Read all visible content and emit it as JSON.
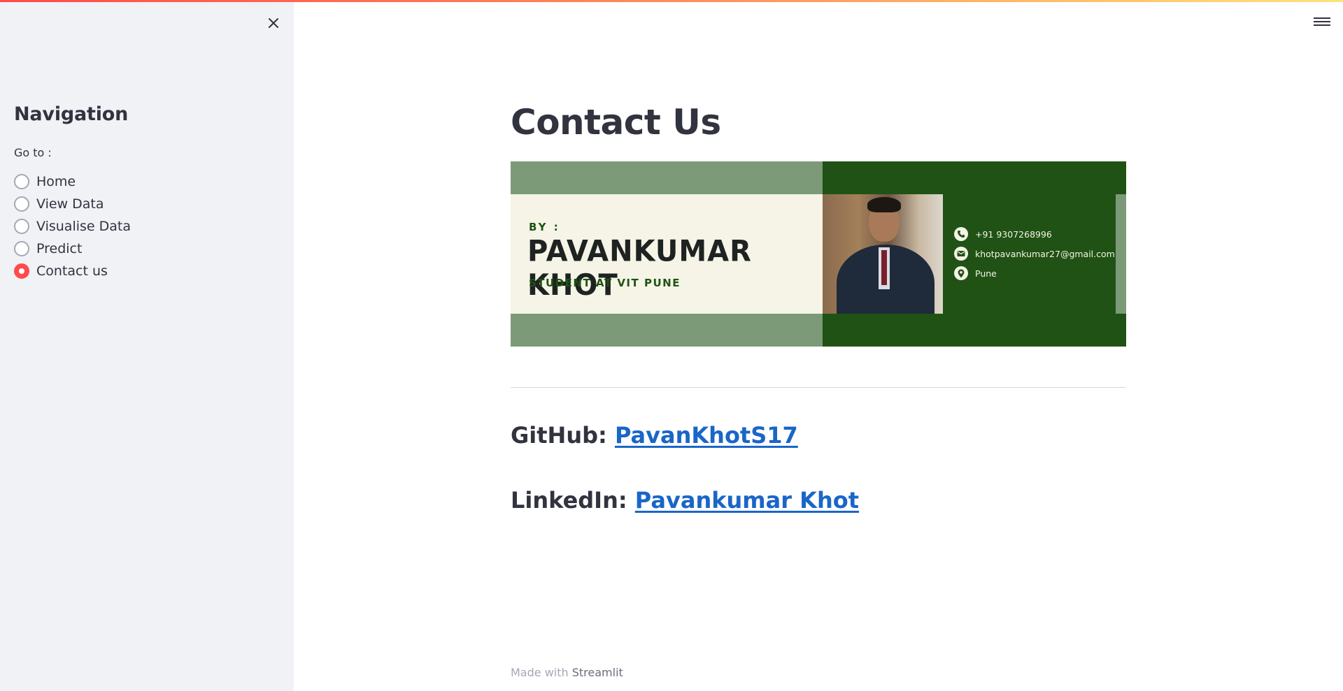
{
  "sidebar": {
    "title": "Navigation",
    "goto_label": "Go to :",
    "options": [
      {
        "label": "Home",
        "selected": false
      },
      {
        "label": "View Data",
        "selected": false
      },
      {
        "label": "Visualise Data",
        "selected": false
      },
      {
        "label": "Predict",
        "selected": false
      },
      {
        "label": "Contact us",
        "selected": true
      }
    ]
  },
  "main": {
    "title": "Contact Us",
    "banner": {
      "by": "BY :",
      "name": "PAVANKUMAR KHOT",
      "subtitle": "STUDENT AT VIT PUNE",
      "phone": "+91 9307268996",
      "email": "khotpavankumar27@gmail.com",
      "location": "Pune"
    },
    "github": {
      "label": "GitHub:",
      "link_text": "PavanKhotS17"
    },
    "linkedin": {
      "label": "LinkedIn:",
      "link_text": "Pavankumar Khot"
    }
  },
  "footer": {
    "prefix": "Made with",
    "brand": "Streamlit"
  },
  "colors": {
    "accent": "#ff4b4b",
    "link": "#1a66c8",
    "banner_dark_green": "#1f5214",
    "banner_sage": "#7c9a77",
    "banner_cream": "#f5f4e6"
  },
  "icons": {
    "close": "close-icon",
    "menu": "hamburger-menu-icon",
    "phone": "phone-icon",
    "email": "mail-icon",
    "location": "location-pin-icon"
  }
}
